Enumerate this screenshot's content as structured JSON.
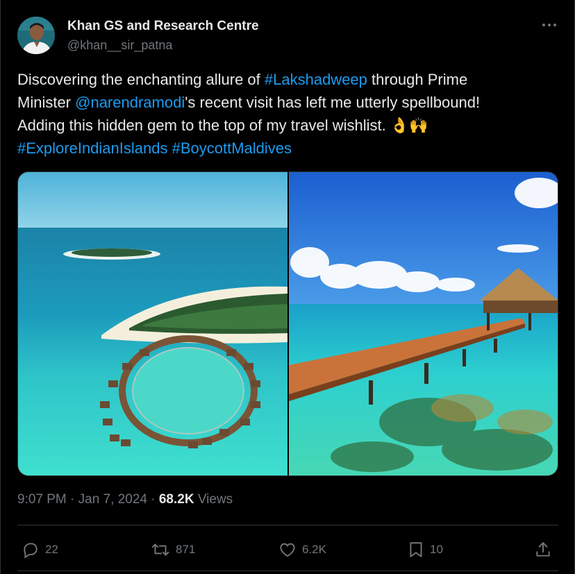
{
  "author": {
    "name": "Khan GS and Research Centre",
    "handle": "@khan__sir_patna"
  },
  "tweet": {
    "line1_pre": "Discovering the enchanting allure of ",
    "line1_tag": "#Lakshadweep",
    "line1_post": " through Prime",
    "line2_pre": "Minister ",
    "line2_mention": "@narendramodi",
    "line2_post": "'s recent visit has left me utterly spellbound!",
    "line3": "Adding this hidden gem to the top of my travel wishlist. ",
    "emoji": "👌🙌",
    "tag2": "#ExploreIndianIslands",
    "tag3": "#BoycottMaldives"
  },
  "meta": {
    "time": "9:07 PM",
    "sep1": " · ",
    "date": "Jan 7, 2024",
    "sep2": " · ",
    "views_count": "68.2K",
    "views_label": " Views"
  },
  "actions": {
    "replies": "22",
    "reposts": "871",
    "likes": "6.2K",
    "bookmarks": "10"
  },
  "colors": {
    "link": "#1d9bf0",
    "muted": "#71767b",
    "text": "#e7e9ea",
    "background": "#000000"
  }
}
